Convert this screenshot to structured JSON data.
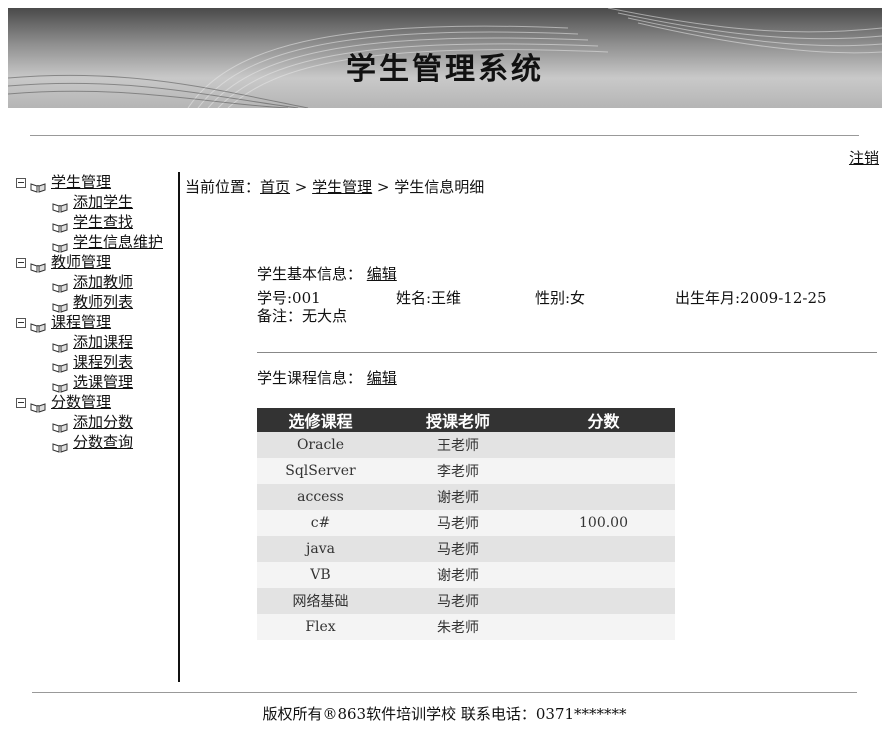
{
  "header": {
    "title": "学生管理系统"
  },
  "logout_label": "注销",
  "nav": {
    "groups": [
      {
        "label": "学生管理",
        "items": [
          "添加学生",
          "学生查找",
          "学生信息维护"
        ]
      },
      {
        "label": "教师管理",
        "items": [
          "添加教师",
          "教师列表"
        ]
      },
      {
        "label": "课程管理",
        "items": [
          "添加课程",
          "课程列表",
          "选课管理"
        ]
      },
      {
        "label": "分数管理",
        "items": [
          "添加分数",
          "分数查询"
        ]
      }
    ]
  },
  "breadcrumb": {
    "prefix": "当前位置：",
    "home": "首页",
    "sep1": " > ",
    "section": "学生管理",
    "sep2": " > ",
    "current": "学生信息明细"
  },
  "basic_info": {
    "title": "学生基本信息：",
    "edit_label": "编辑",
    "student_id": "学号:001",
    "name": "姓名:王维",
    "gender": "性别:女",
    "birth": "出生年月:2009-12-25",
    "remark": "备注：无大点"
  },
  "course_info": {
    "title": "学生课程信息：",
    "edit_label": "编辑",
    "columns": [
      "选修课程",
      "授课老师",
      "分数"
    ],
    "rows": [
      [
        "Oracle",
        "王老师",
        ""
      ],
      [
        "SqlServer",
        "李老师",
        ""
      ],
      [
        "access",
        "谢老师",
        ""
      ],
      [
        "c#",
        "马老师",
        "100.00"
      ],
      [
        "java",
        "马老师",
        ""
      ],
      [
        "VB",
        "谢老师",
        ""
      ],
      [
        "网络基础",
        "马老师",
        ""
      ],
      [
        "Flex",
        "朱老师",
        ""
      ]
    ]
  },
  "footer": {
    "text": "版权所有®863软件培训学校 联系电话：0371*******"
  }
}
